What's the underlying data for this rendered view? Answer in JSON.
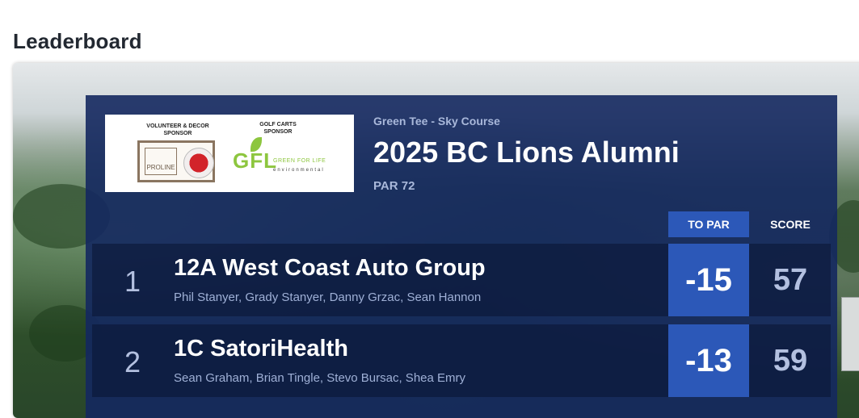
{
  "page": {
    "heading": "Leaderboard"
  },
  "sponsors": [
    {
      "caption": "VOLUNTEER & DECOR SPONSOR",
      "logo_text": "PROLINE"
    },
    {
      "caption": "GOLF CARTS SPONSOR",
      "logo_text": "GFL",
      "tagline": "GREEN FOR LIFE",
      "subtext": "environmental"
    }
  ],
  "event": {
    "course": "Green Tee - Sky Course",
    "title": "2025 BC Lions Alumni",
    "par": "PAR 72"
  },
  "columns": {
    "to_par": "TO PAR",
    "score": "SCORE"
  },
  "rows": [
    {
      "rank": "1",
      "team": "12A West Coast Auto Group",
      "players": "Phil Stanyer, Grady Stanyer, Danny Grzac, Sean Hannon",
      "to_par": "-15",
      "score": "57"
    },
    {
      "rank": "2",
      "team": "1C SatoriHealth",
      "players": "Sean Graham, Brian Tingle, Stevo Bursac, Shea Emry",
      "to_par": "-13",
      "score": "59"
    }
  ],
  "colors": {
    "panel": "#14285f",
    "accent": "#2c58b8",
    "muted_text": "#a9b8da"
  }
}
